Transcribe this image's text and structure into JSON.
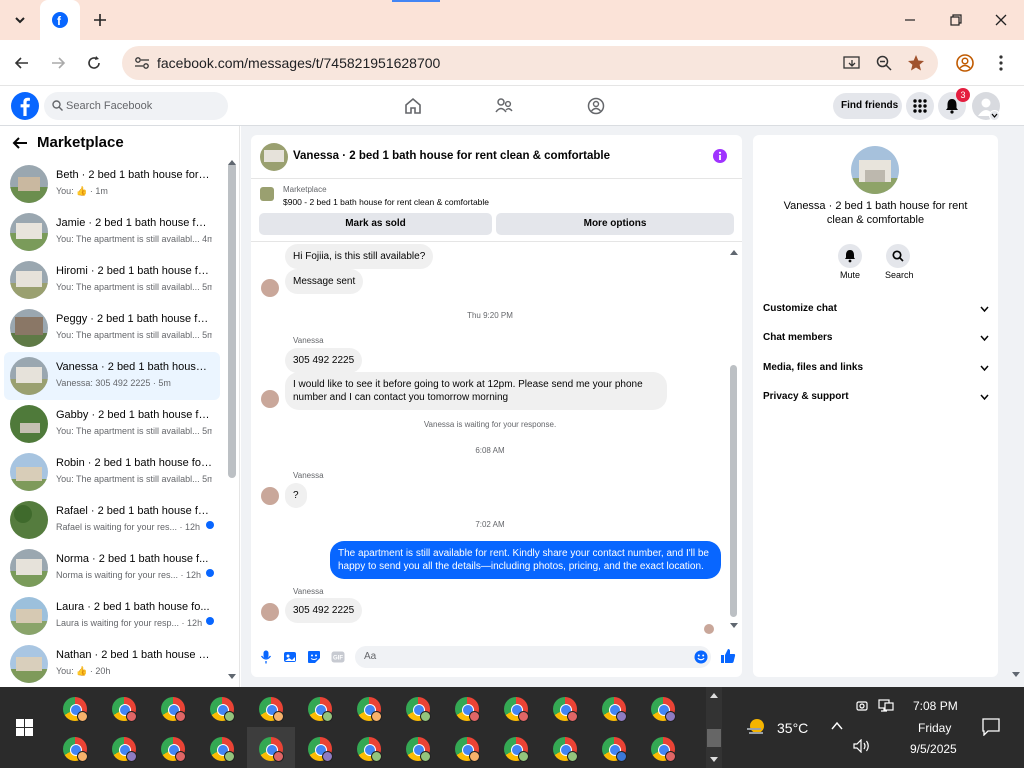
{
  "browser": {
    "url": "facebook.com/messages/t/745821951628700"
  },
  "fb": {
    "search_placeholder": "Search Facebook",
    "find_friends": "Find friends",
    "notif_count": "3"
  },
  "left": {
    "title": "Marketplace",
    "conversations": [
      {
        "name": "Beth · 2 bed 1 bath house for re...",
        "preview": "You: 👍 · 1m"
      },
      {
        "name": "Jamie · 2 bed 1 bath house for r...",
        "preview": "You: The apartment is still availabl... 4m"
      },
      {
        "name": "Hiromi · 2 bed 1 bath house for...",
        "preview": "You: The apartment is still availabl... 5m"
      },
      {
        "name": "Peggy · 2 bed 1 bath house for ...",
        "preview": "You: The apartment is still availabl... 5m"
      },
      {
        "name": "Vanessa · 2 bed 1 bath house fo...",
        "preview": "Vanessa: 305 492 2225 · 5m"
      },
      {
        "name": "Gabby · 2 bed 1 bath house for ...",
        "preview": "You: The apartment is still availabl... 5m"
      },
      {
        "name": "Robin · 2 bed 1 bath house for ...",
        "preview": "You: The apartment is still availabl... 5m"
      },
      {
        "name": "Rafael · 2 bed 1 bath house fo...",
        "preview": "Rafael is waiting for your res... · 12h"
      },
      {
        "name": "Norma · 2 bed 1 bath house f...",
        "preview": "Norma is waiting for your res... · 12h"
      },
      {
        "name": "Laura · 2 bed 1 bath house fo...",
        "preview": "Laura is waiting for your resp... · 12h"
      },
      {
        "name": "Nathan · 2 bed 1 bath house fo...",
        "preview": "You: 👍 · 20h"
      }
    ]
  },
  "chat": {
    "title": "Vanessa · 2 bed 1 bath house for rent clean & comfortable",
    "mp_label": "Marketplace",
    "mp_item": "$900 - 2 bed 1 bath house for rent clean & comfortable",
    "mark_sold": "Mark as sold",
    "more_options": "More options",
    "msg1": "Hi Fojiia, is this still available?",
    "msg2": "Message sent",
    "ts1": "Thu 9:20 PM",
    "sender": "Vanessa",
    "msg3": "305 492 2225",
    "msg4a": "I would like to see it before going to work at 12pm. Please send me your phone",
    "msg4b": "number and I can contact you tomorrow morning",
    "waiting": "Vanessa is waiting for your response.",
    "ts2": "6:08 AM",
    "msg5": "?",
    "ts3": "7:02 AM",
    "me1a": "The apartment is still available for rent. Kindly share your contact number, and I'll be",
    "me1b": "happy to send you all the details—including photos, pricing, and the exact location.",
    "msg6": "305 492 2225",
    "input_placeholder": "Aa"
  },
  "right": {
    "name_line1": "Vanessa · 2 bed 1 bath house for rent",
    "name_line2": "clean & comfortable",
    "mute": "Mute",
    "search": "Search",
    "rows": [
      "Customize chat",
      "Chat members",
      "Media, files and links",
      "Privacy & support"
    ]
  },
  "taskbar": {
    "temp": "35°C",
    "time": "7:08 PM",
    "day": "Friday",
    "date": "9/5/2025"
  },
  "colors": {
    "accent": "#0866ff",
    "fb_blue": "#0866ff",
    "badge_red": "#e41e3f"
  }
}
